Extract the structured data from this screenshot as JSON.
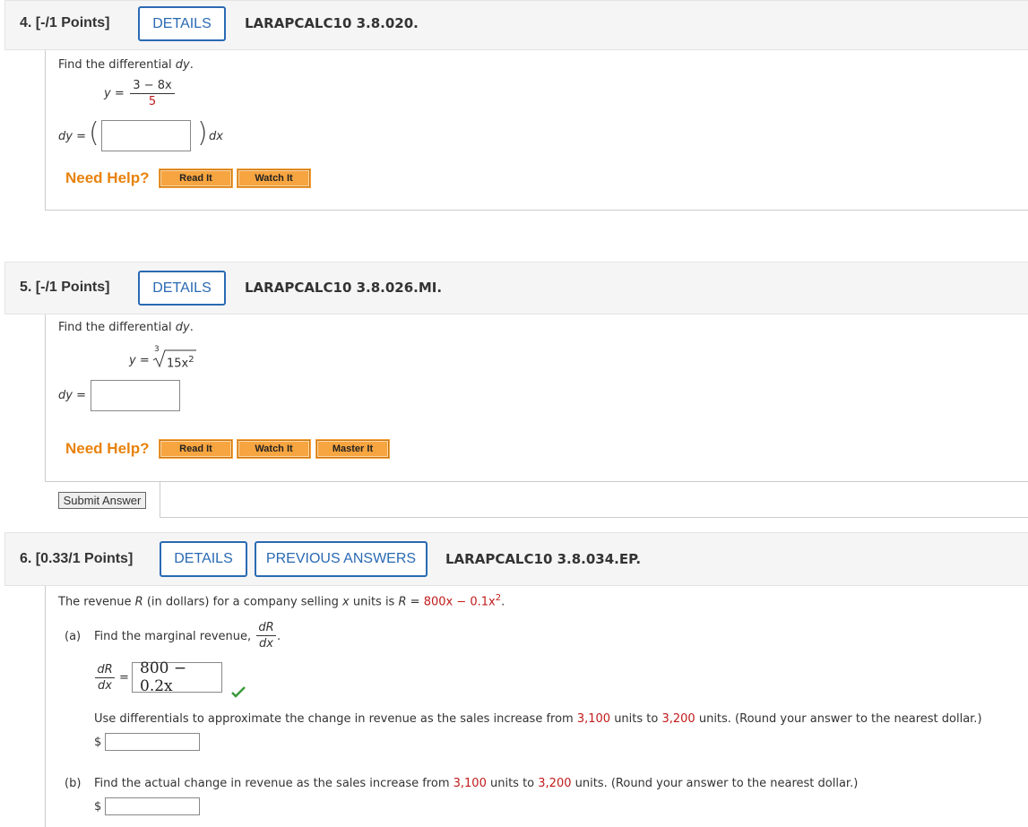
{
  "q4": {
    "num": "4.",
    "points": "[-/1 Points]",
    "details": "DETAILS",
    "id": "LARAPCALC10 3.8.020.",
    "prompt_pre": "Find the differential ",
    "prompt_var": "dy",
    "prompt_post": ".",
    "y_label": "y =",
    "numerator": "3 − 8x",
    "denominator": "5",
    "dy_label": "dy =",
    "dx_label": "dx",
    "need_help": "Need Help?",
    "read_it": "Read It",
    "watch_it": "Watch It"
  },
  "q5": {
    "num": "5.",
    "points": "[-/1 Points]",
    "details": "DETAILS",
    "id": "LARAPCALC10 3.8.026.MI.",
    "prompt_pre": "Find the differential ",
    "prompt_var": "dy",
    "prompt_post": ".",
    "y_label": "y =",
    "root_index": "3",
    "radicand": "15x",
    "exponent": "2",
    "dy_label": "dy =",
    "need_help": "Need Help?",
    "read_it": "Read It",
    "watch_it": "Watch It",
    "master_it": "Master It",
    "submit": "Submit Answer"
  },
  "q6": {
    "num": "6.",
    "points": "[0.33/1 Points]",
    "details": "DETAILS",
    "previous": "PREVIOUS ANSWERS",
    "id": "LARAPCALC10 3.8.034.EP.",
    "intro_1": "The revenue ",
    "intro_R": "R",
    "intro_2": " (in dollars) for a company selling ",
    "intro_x": "x",
    "intro_3": " units is ",
    "intro_R2": "R",
    "intro_eq": " = ",
    "intro_expr": "800x − 0.1x",
    "intro_exp": "2",
    "intro_end": ".",
    "part_a_label": "(a)",
    "part_a_text": "Find the marginal revenue,",
    "dR": "dR",
    "dx": "dx",
    "eq": "=",
    "answer_a": "800 − 0.2x",
    "approx_1": "Use differentials to approximate the change in revenue as the sales increase from ",
    "from_units": "3,100",
    "approx_2": " units to ",
    "to_units": "3,200",
    "approx_3": " units. (Round your answer to the nearest dollar.)",
    "dollar": "$",
    "part_b_label": "(b)",
    "actual_1": "Find the actual change in revenue as the sales increase from ",
    "actual_2": " units to ",
    "actual_3": " units. (Round your answer to the nearest dollar.)",
    "check_color": "#3a9a3a"
  }
}
